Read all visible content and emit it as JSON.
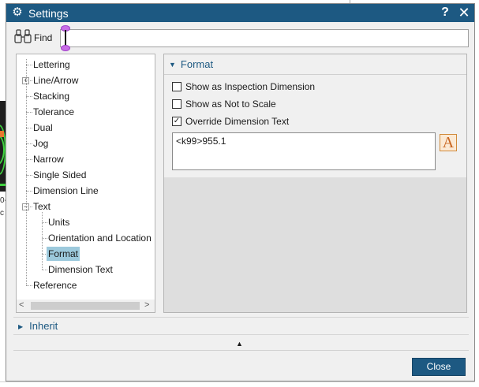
{
  "dialog": {
    "title": "Settings",
    "help_label": "?",
    "close_x_label": "✕"
  },
  "find": {
    "label": "Find",
    "value": "",
    "icon": "binoculars-icon"
  },
  "tree": {
    "items": [
      {
        "label": "Lettering",
        "selected": false
      },
      {
        "label": "Line/Arrow",
        "selected": false,
        "expander": "+"
      },
      {
        "label": "Stacking",
        "selected": false
      },
      {
        "label": "Tolerance",
        "selected": false
      },
      {
        "label": "Dual",
        "selected": false
      },
      {
        "label": "Jog",
        "selected": false
      },
      {
        "label": "Narrow",
        "selected": false
      },
      {
        "label": "Single Sided",
        "selected": false
      },
      {
        "label": "Dimension Line",
        "selected": false
      },
      {
        "label": "Text",
        "selected": false,
        "expander": "−"
      },
      {
        "label": "Units",
        "selected": false,
        "child": true
      },
      {
        "label": "Orientation and Location",
        "selected": false,
        "child": true
      },
      {
        "label": "Format",
        "selected": true,
        "child": true
      },
      {
        "label": "Dimension Text",
        "selected": false,
        "child": true
      },
      {
        "label": "Reference",
        "selected": false
      }
    ]
  },
  "format": {
    "header": "Format",
    "checkboxes": [
      {
        "label": "Show as Inspection Dimension",
        "checked": false
      },
      {
        "label": "Show as Not to Scale",
        "checked": false
      },
      {
        "label": "Override Dimension Text",
        "checked": true
      }
    ],
    "override_text": "<k99>955.1",
    "font_button_label": "A"
  },
  "inherit": {
    "label": "Inherit"
  },
  "footer": {
    "close_label": "Close"
  },
  "background": {
    "line1": "0-",
    "line2": "c"
  },
  "colors": {
    "titlebar": "#1d5982",
    "accent_text": "#1d5982",
    "selection": "#9cc9dc",
    "close_button": "#1d5982",
    "font_button_fg": "#c8641e"
  }
}
